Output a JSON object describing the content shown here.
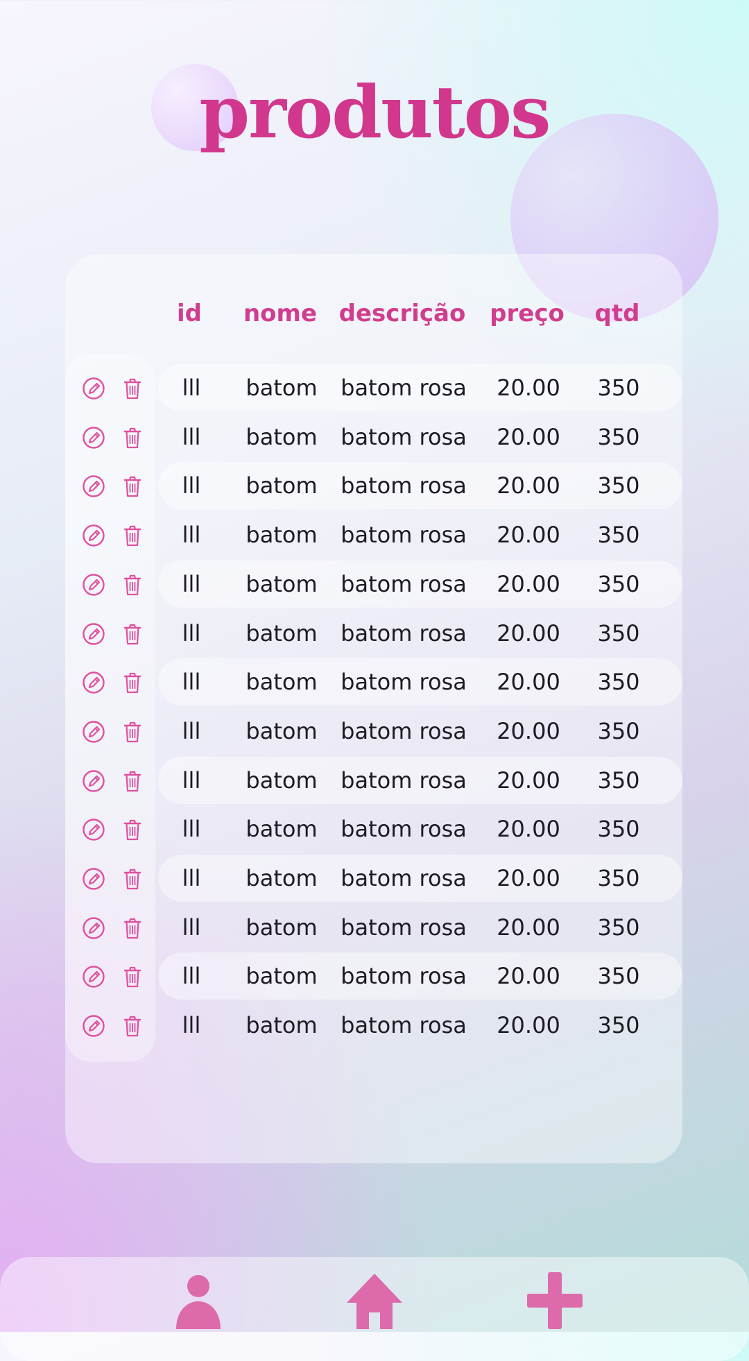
{
  "page": {
    "title": "produtos"
  },
  "colors": {
    "accent": "#d13d8e",
    "icon": "#e0509f",
    "nav_icon": "#dd6aaa",
    "text": "#1d1a22"
  },
  "table": {
    "columns": [
      "id",
      "nome",
      "descrição",
      "preço",
      "qtd"
    ],
    "row_actions": [
      "edit-icon",
      "trash-icon"
    ],
    "rows": [
      {
        "id": "lll",
        "nome": "batom",
        "descricao": "batom rosa",
        "preco": "20.00",
        "qtd": "350"
      },
      {
        "id": "lll",
        "nome": "batom",
        "descricao": "batom rosa",
        "preco": "20.00",
        "qtd": "350"
      },
      {
        "id": "lll",
        "nome": "batom",
        "descricao": "batom rosa",
        "preco": "20.00",
        "qtd": "350"
      },
      {
        "id": "lll",
        "nome": "batom",
        "descricao": "batom rosa",
        "preco": "20.00",
        "qtd": "350"
      },
      {
        "id": "lll",
        "nome": "batom",
        "descricao": "batom rosa",
        "preco": "20.00",
        "qtd": "350"
      },
      {
        "id": "lll",
        "nome": "batom",
        "descricao": "batom rosa",
        "preco": "20.00",
        "qtd": "350"
      },
      {
        "id": "lll",
        "nome": "batom",
        "descricao": "batom rosa",
        "preco": "20.00",
        "qtd": "350"
      },
      {
        "id": "lll",
        "nome": "batom",
        "descricao": "batom rosa",
        "preco": "20.00",
        "qtd": "350"
      },
      {
        "id": "lll",
        "nome": "batom",
        "descricao": "batom rosa",
        "preco": "20.00",
        "qtd": "350"
      },
      {
        "id": "lll",
        "nome": "batom",
        "descricao": "batom rosa",
        "preco": "20.00",
        "qtd": "350"
      },
      {
        "id": "lll",
        "nome": "batom",
        "descricao": "batom rosa",
        "preco": "20.00",
        "qtd": "350"
      },
      {
        "id": "lll",
        "nome": "batom",
        "descricao": "batom rosa",
        "preco": "20.00",
        "qtd": "350"
      },
      {
        "id": "lll",
        "nome": "batom",
        "descricao": "batom rosa",
        "preco": "20.00",
        "qtd": "350"
      },
      {
        "id": "lll",
        "nome": "batom",
        "descricao": "batom rosa",
        "preco": "20.00",
        "qtd": "350"
      }
    ]
  },
  "bottom_nav": {
    "items": [
      {
        "icon": "user-icon"
      },
      {
        "icon": "home-icon"
      },
      {
        "icon": "plus-icon"
      }
    ]
  }
}
